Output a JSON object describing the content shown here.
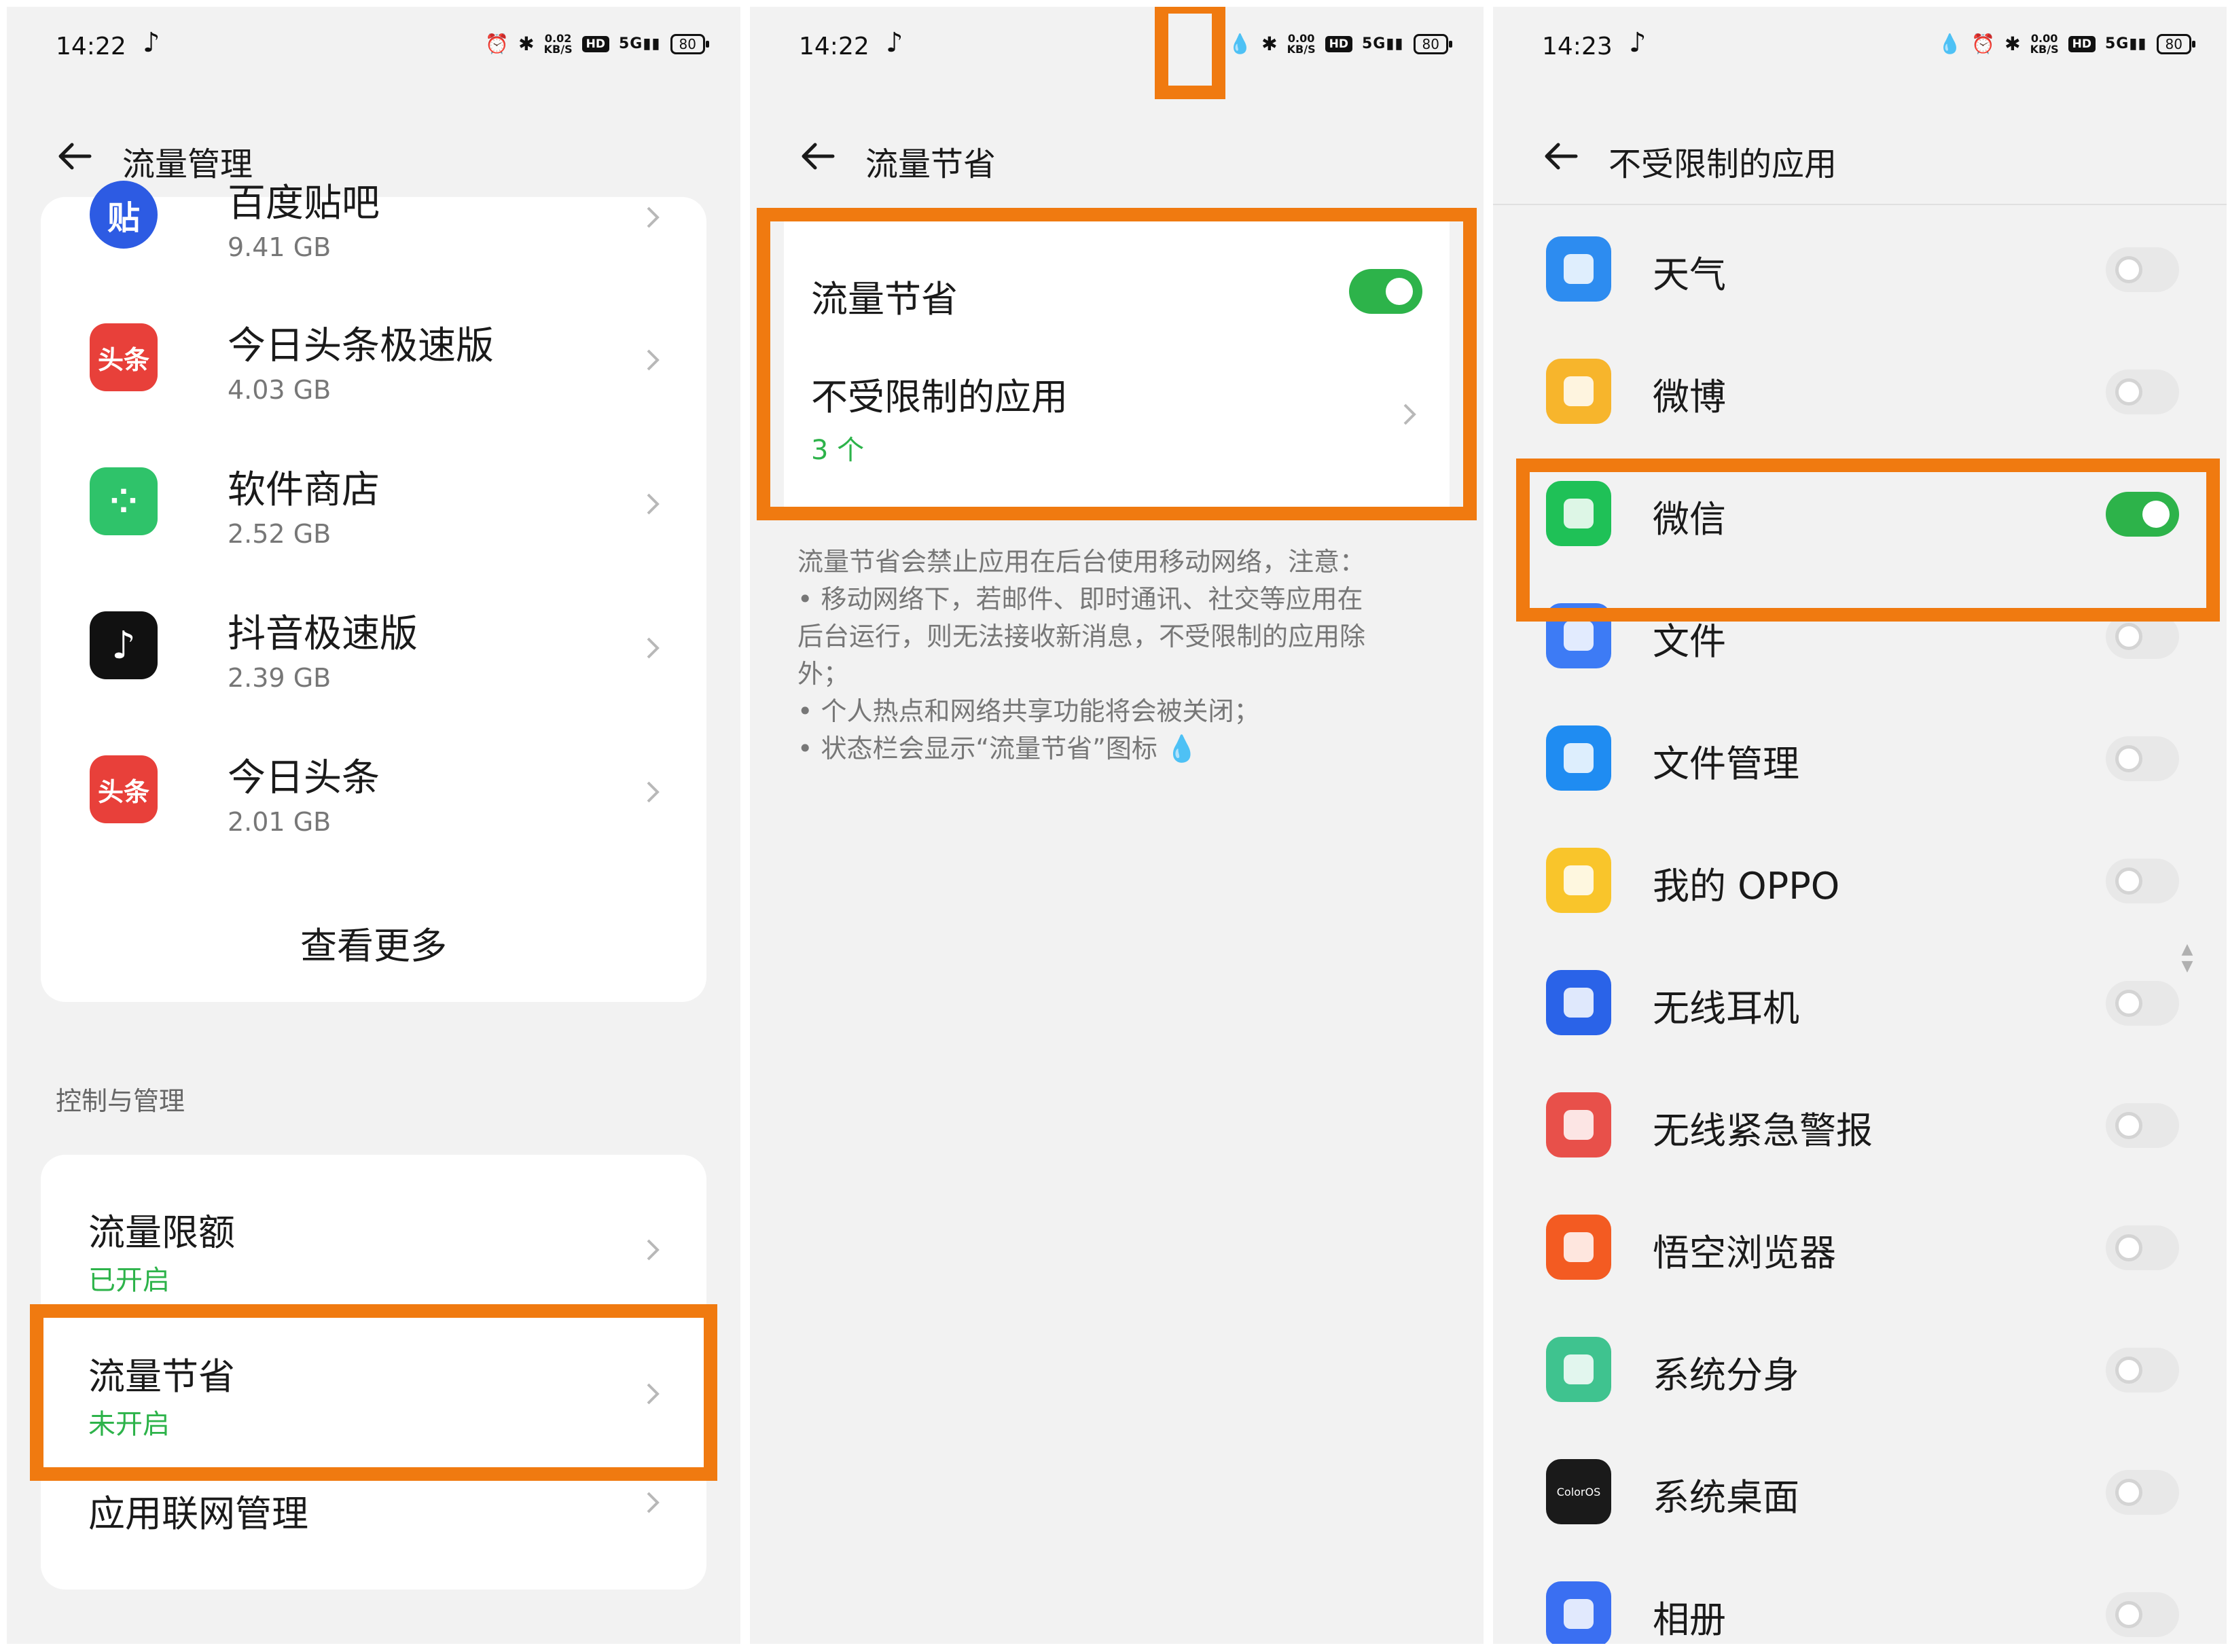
{
  "colors": {
    "accent_green": "#2db34a",
    "highlight_orange": "#f07a10",
    "panel_bg": "#f2f2f2",
    "card_bg": "#ffffff"
  },
  "panel1": {
    "status": {
      "time": "14:22",
      "speed_top": "0.02",
      "speed_unit": "KB/S",
      "hd": "HD",
      "net": "5G",
      "battery": "80"
    },
    "header_title": "流量管理",
    "apps": [
      {
        "name": "百度贴吧",
        "usage": "9.41 GB",
        "icon": "tieba-icon",
        "icon_text": "贴"
      },
      {
        "name": "今日头条极速版",
        "usage": "4.03 GB",
        "icon": "toutiao-lite-icon",
        "icon_text": "头条"
      },
      {
        "name": "软件商店",
        "usage": "2.52 GB",
        "icon": "app-store-icon",
        "icon_text": "⁘"
      },
      {
        "name": "抖音极速版",
        "usage": "2.39 GB",
        "icon": "douyin-lite-icon",
        "icon_text": "♪"
      },
      {
        "name": "今日头条",
        "usage": "2.01 GB",
        "icon": "toutiao-icon",
        "icon_text": "头条"
      }
    ],
    "see_more": "查看更多",
    "section_label": "控制与管理",
    "menu": [
      {
        "title": "流量限额",
        "sub": "已开启"
      },
      {
        "title": "流量节省",
        "sub": "未开启"
      },
      {
        "title": "应用联网管理",
        "sub": ""
      }
    ]
  },
  "panel2": {
    "status": {
      "time": "14:22",
      "speed_top": "0.00",
      "speed_unit": "KB/S",
      "hd": "HD",
      "net": "5G",
      "battery": "80"
    },
    "header_title": "流量节省",
    "data_saver_label": "流量节省",
    "data_saver_on": true,
    "unrestricted_label": "不受限制的应用",
    "unrestricted_count": "3 个",
    "description": [
      "流量节省会禁止应用在后台使用移动网络，注意：",
      "• 移动网络下，若邮件、即时通讯、社交等应用在",
      "后台运行，则无法接收新消息，不受限制的应用除",
      "外；",
      "• 个人热点和网络共享功能将会被关闭；",
      "• 状态栏会显示“流量节省”图标"
    ]
  },
  "panel3": {
    "status": {
      "time": "14:23",
      "speed_top": "0.00",
      "speed_unit": "KB/S",
      "hd": "HD",
      "net": "5G",
      "battery": "80"
    },
    "header_title": "不受限制的应用",
    "apps": [
      {
        "name": "天气",
        "on": false,
        "icon": "weather-icon",
        "color": "#2d8cf0"
      },
      {
        "name": "微博",
        "on": false,
        "icon": "weibo-icon",
        "color": "#f7b52c"
      },
      {
        "name": "微信",
        "on": true,
        "icon": "wechat-icon",
        "color": "#1fc157"
      },
      {
        "name": "文件",
        "on": false,
        "icon": "files-icon",
        "color": "#3d7bf5"
      },
      {
        "name": "文件管理",
        "on": false,
        "icon": "file-manager-icon",
        "color": "#1f8cf2"
      },
      {
        "name": "我的 OPPO",
        "on": false,
        "icon": "my-oppo-icon",
        "color": "#f9c52b"
      },
      {
        "name": "无线耳机",
        "on": false,
        "icon": "wireless-earphones-icon",
        "color": "#2a63e8"
      },
      {
        "name": "无线紧急警报",
        "on": false,
        "icon": "emergency-alert-icon",
        "color": "#e8504a"
      },
      {
        "name": "悟空浏览器",
        "on": false,
        "icon": "wukong-browser-icon",
        "color": "#f35b22"
      },
      {
        "name": "系统分身",
        "on": false,
        "icon": "system-clone-icon",
        "color": "#3fc38f"
      },
      {
        "name": "系统桌面",
        "on": false,
        "icon": "coloros-launcher-icon",
        "color": "#1a1a1a",
        "icon_text": "ColorOS"
      },
      {
        "name": "相册",
        "on": false,
        "icon": "gallery-icon",
        "color": "#3a6ff2"
      }
    ]
  }
}
